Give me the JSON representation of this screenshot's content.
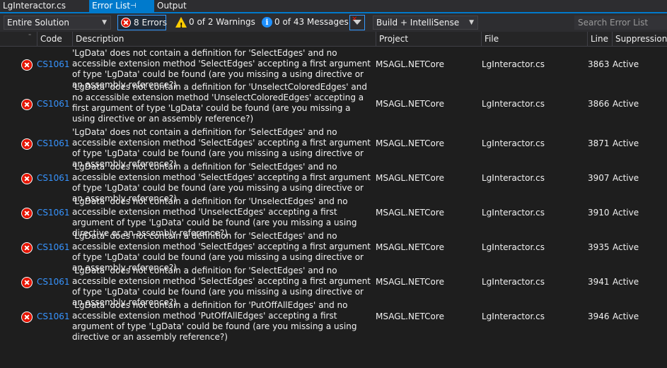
{
  "tabs": {
    "file": "LgInteractor.cs",
    "active": "Error List",
    "active_pin": "⊣",
    "output": "Output"
  },
  "toolbar": {
    "scope": "Entire Solution",
    "errors": "8 Errors",
    "warnings": "0 of 2 Warnings",
    "messages": "0 of 43 Messages",
    "build_filter": "Build + IntelliSense",
    "search_placeholder": "Search Error List"
  },
  "columns": {
    "code": "Code",
    "description": "Description",
    "project": "Project",
    "file": "File",
    "line": "Line",
    "suppression": "Suppression State"
  },
  "colors": {
    "accent": "#007acc",
    "error": "#e51400",
    "link": "#3794ff",
    "background": "#1e1e1e"
  },
  "errors": [
    {
      "code": "CS1061",
      "description": "'LgData' does not contain a definition for 'SelectEdges' and no accessible extension method 'SelectEdges' accepting a first argument of type 'LgData' could be found (are you missing a using directive or an assembly reference?)",
      "project": "MSAGL.NETCore",
      "file": "LgInteractor.cs",
      "line": "3863",
      "suppression": "Active"
    },
    {
      "code": "CS1061",
      "description": "'LgData' does not contain a definition for 'UnselectColoredEdges' and no accessible extension method 'UnselectColoredEdges' accepting a first argument of type 'LgData' could be found (are you missing a using directive or an assembly reference?)",
      "project": "MSAGL.NETCore",
      "file": "LgInteractor.cs",
      "line": "3866",
      "suppression": "Active"
    },
    {
      "code": "CS1061",
      "description": "'LgData' does not contain a definition for 'SelectEdges' and no accessible extension method 'SelectEdges' accepting a first argument of type 'LgData' could be found (are you missing a using directive or an assembly reference?)",
      "project": "MSAGL.NETCore",
      "file": "LgInteractor.cs",
      "line": "3871",
      "suppression": "Active"
    },
    {
      "code": "CS1061",
      "description": "'LgData' does not contain a definition for 'SelectEdges' and no accessible extension method 'SelectEdges' accepting a first argument of type 'LgData' could be found (are you missing a using directive or an assembly reference?)",
      "project": "MSAGL.NETCore",
      "file": "LgInteractor.cs",
      "line": "3907",
      "suppression": "Active"
    },
    {
      "code": "CS1061",
      "description": "'LgData' does not contain a definition for 'UnselectEdges' and no accessible extension method 'UnselectEdges' accepting a first argument of type 'LgData' could be found (are you missing a using directive or an assembly reference?)",
      "project": "MSAGL.NETCore",
      "file": "LgInteractor.cs",
      "line": "3910",
      "suppression": "Active"
    },
    {
      "code": "CS1061",
      "description": "'LgData' does not contain a definition for 'SelectEdges' and no accessible extension method 'SelectEdges' accepting a first argument of type 'LgData' could be found (are you missing a using directive or an assembly reference?)",
      "project": "MSAGL.NETCore",
      "file": "LgInteractor.cs",
      "line": "3935",
      "suppression": "Active"
    },
    {
      "code": "CS1061",
      "description": "'LgData' does not contain a definition for 'SelectEdges' and no accessible extension method 'SelectEdges' accepting a first argument of type 'LgData' could be found (are you missing a using directive or an assembly reference?)",
      "project": "MSAGL.NETCore",
      "file": "LgInteractor.cs",
      "line": "3941",
      "suppression": "Active"
    },
    {
      "code": "CS1061",
      "description": "'LgData' does not contain a definition for 'PutOffAllEdges' and no accessible extension method 'PutOffAllEdges' accepting a first argument of type 'LgData' could be found (are you missing a using directive or an assembly reference?)",
      "project": "MSAGL.NETCore",
      "file": "LgInteractor.cs",
      "line": "3946",
      "suppression": "Active"
    }
  ]
}
